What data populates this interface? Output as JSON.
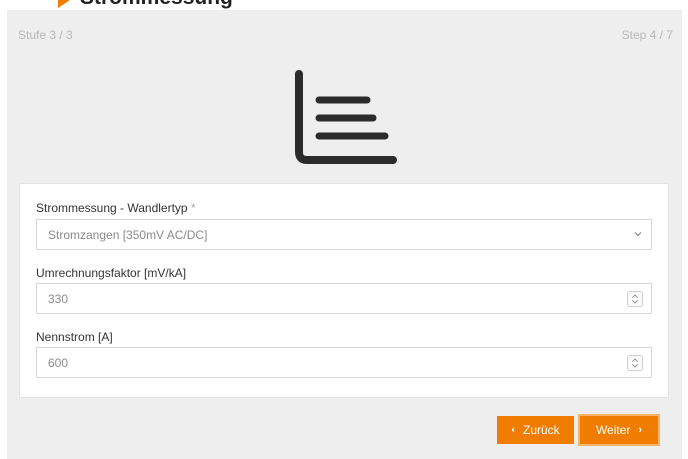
{
  "page": {
    "heading": "Strommessung"
  },
  "wizard": {
    "stage": "Stufe 3 / 3",
    "step": "Step 4 / 7",
    "hero_icon": "bar-list-icon"
  },
  "form": {
    "transformer_type": {
      "label": "Strommessung - Wandlertyp",
      "required_mark": "*",
      "value": "Stromzangen [350mV AC/DC]"
    },
    "conversion_factor": {
      "label": "Umrechnungsfaktor [mV/kA]",
      "value": "330"
    },
    "rated_current": {
      "label": "Nennstrom [A]",
      "value": "600"
    }
  },
  "nav": {
    "back_label": "Zurück",
    "back_glyph": "‹",
    "next_label": "Weiter",
    "next_glyph": "›"
  },
  "colors": {
    "accent": "#f07d00",
    "panel": "#eeeeee"
  }
}
